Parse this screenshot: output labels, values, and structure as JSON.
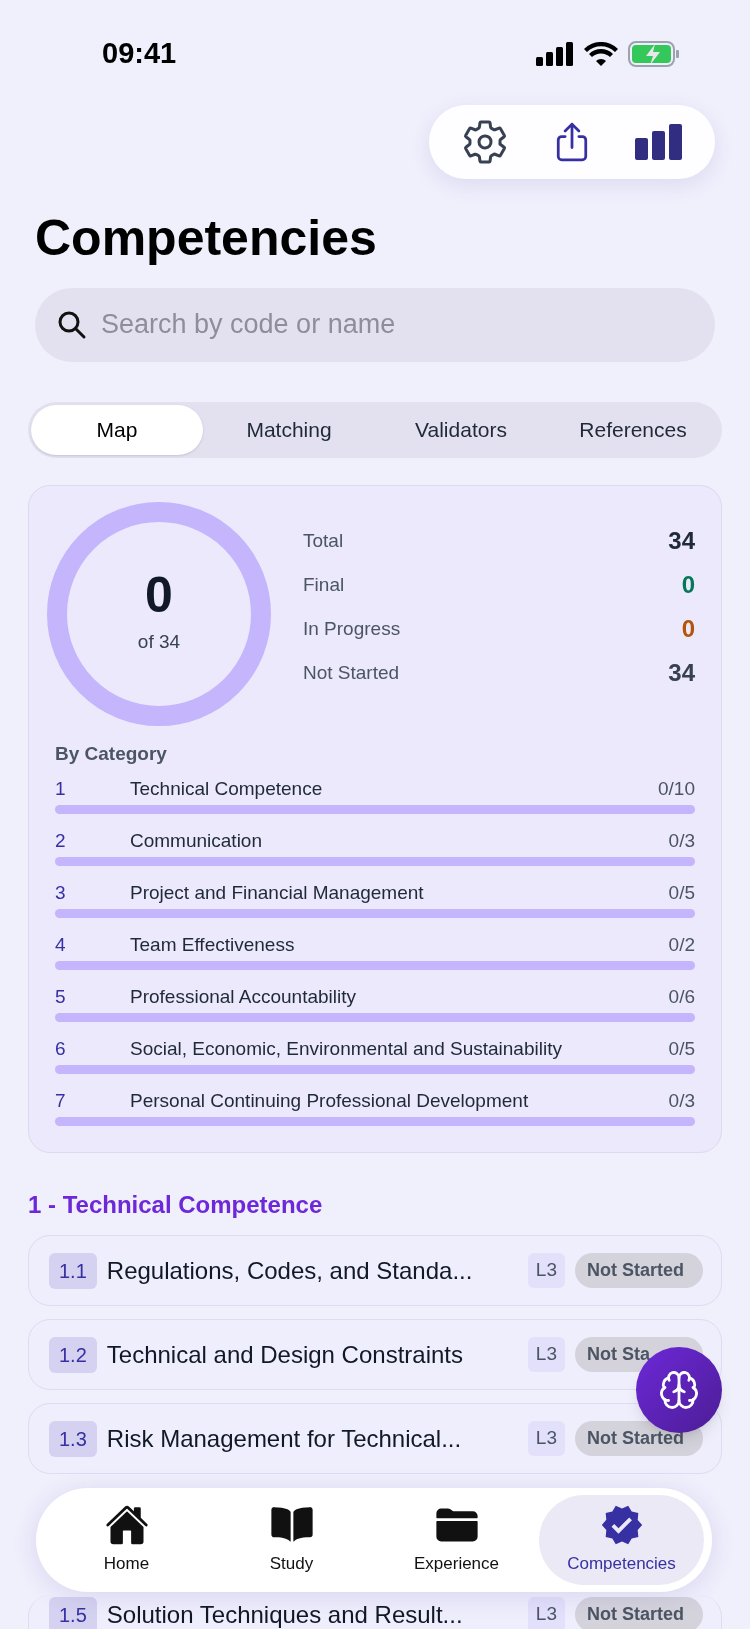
{
  "status_bar": {
    "time": "09:41"
  },
  "title": "Competencies",
  "search": {
    "placeholder": "Search by code or name"
  },
  "tabs": [
    {
      "label": "Map",
      "selected": true
    },
    {
      "label": "Matching",
      "selected": false
    },
    {
      "label": "Validators",
      "selected": false
    },
    {
      "label": "References",
      "selected": false
    }
  ],
  "summary": {
    "ring": {
      "value": "0",
      "caption": "of 34",
      "level": 0
    },
    "stats": [
      {
        "label": "Total",
        "value": "34",
        "color": "#1f2937"
      },
      {
        "label": "Final",
        "value": "0",
        "color": "#047857"
      },
      {
        "label": "In Progress",
        "value": "0",
        "color": "#b45309"
      },
      {
        "label": "Not Started",
        "value": "34",
        "color": "#374151"
      }
    ],
    "category_heading": "By Category",
    "categories": [
      {
        "number": "1",
        "name": "Technical Competence",
        "progress": "0/10",
        "level": 0
      },
      {
        "number": "2",
        "name": "Communication",
        "progress": "0/3",
        "level": 0
      },
      {
        "number": "3",
        "name": "Project and Financial Management",
        "progress": "0/5",
        "level": 0
      },
      {
        "number": "4",
        "name": "Team Effectiveness",
        "progress": "0/2",
        "level": 0
      },
      {
        "number": "5",
        "name": "Professional Accountability",
        "progress": "0/6",
        "level": 0
      },
      {
        "number": "6",
        "name": "Social, Economic, Environmental and Sustainability",
        "progress": "0/5",
        "level": 0
      },
      {
        "number": "7",
        "name": "Personal Continuing Professional Development",
        "progress": "0/3",
        "level": 0
      }
    ]
  },
  "section": {
    "heading": "1 - Technical Competence",
    "items": [
      {
        "code": "1.1",
        "name": "Regulations, Codes, and Standa...",
        "level_tag": "L3",
        "status": "Not Started"
      },
      {
        "code": "1.2",
        "name": "Technical and Design Constraints",
        "level_tag": "L3",
        "status": "Not Sta"
      },
      {
        "code": "1.3",
        "name": "Risk Management for Technical...",
        "level_tag": "L3",
        "status": "Not Started"
      },
      {
        "code": "1.5",
        "name": "Solution Techniques and Result...",
        "level_tag": "L3",
        "status": "Not Started"
      }
    ]
  },
  "tab_bar": [
    {
      "label": "Home",
      "selected": false
    },
    {
      "label": "Study",
      "selected": false
    },
    {
      "label": "Experience",
      "selected": false
    },
    {
      "label": "Competencies",
      "selected": true
    }
  ]
}
